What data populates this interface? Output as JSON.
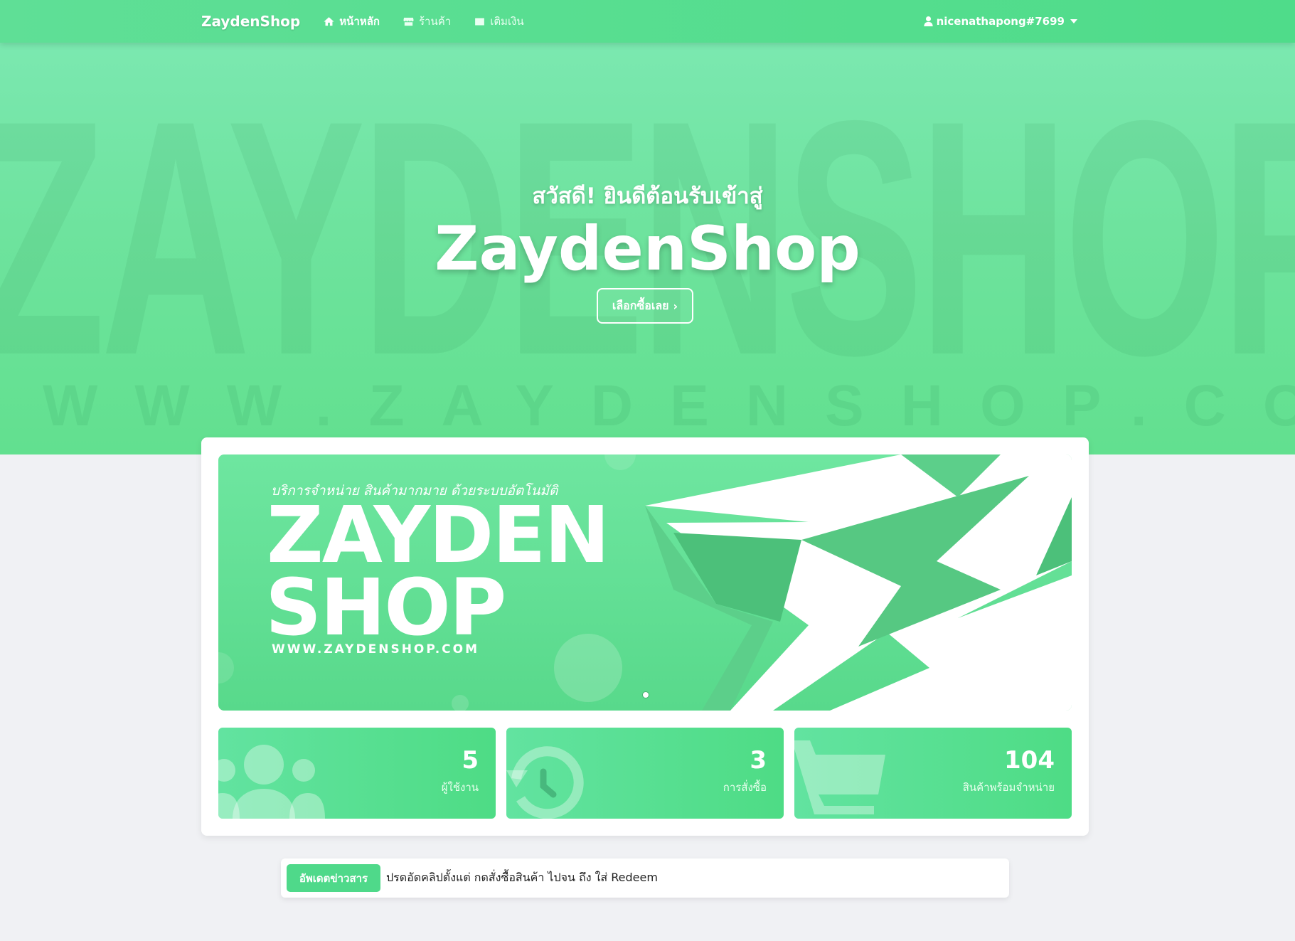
{
  "navbar": {
    "brand": "ZaydenShop",
    "items": [
      {
        "label": "หน้าหลัก",
        "icon": "home-icon",
        "active": true
      },
      {
        "label": "ร้านค้า",
        "icon": "store-icon",
        "active": false
      },
      {
        "label": "เติมเงิน",
        "icon": "wallet-icon",
        "active": false
      }
    ],
    "user": "nicenathapong#7699"
  },
  "hero": {
    "greeting": "สวัสดี! ยินดีต้อนรับเข้าสู่",
    "title": "ZaydenShop",
    "cta": "เลือกซื้อเลย",
    "watermark": "ZAYDENSHOP",
    "watermark_url": "WWW.ZAYDENSHOP.COM"
  },
  "banner": {
    "subtitle": "บริการจำหน่าย สินค้ามากมาย ด้วยระบบอัตโนมัติ",
    "line1": "ZAYDEN",
    "line2": "SHOP",
    "url": "WWW.ZAYDENSHOP.COM"
  },
  "stats": [
    {
      "value": "5",
      "label": "ผู้ใช้งาน",
      "icon": "users-icon"
    },
    {
      "value": "3",
      "label": "การสั่งซื้อ",
      "icon": "history-icon"
    },
    {
      "value": "104",
      "label": "สินค้าพร้อมจำหน่าย",
      "icon": "cart-icon"
    }
  ],
  "news": {
    "badge": "อัพเดตข่าวสาร",
    "text": "ปรดอัดคลิปตั้งแต่ กดสั่งซื้อสินค้า ไปจน ถึง ใส่ Redeem"
  },
  "colors": {
    "accent": "#4fdc8a",
    "page_bg": "#f0f1f4"
  }
}
